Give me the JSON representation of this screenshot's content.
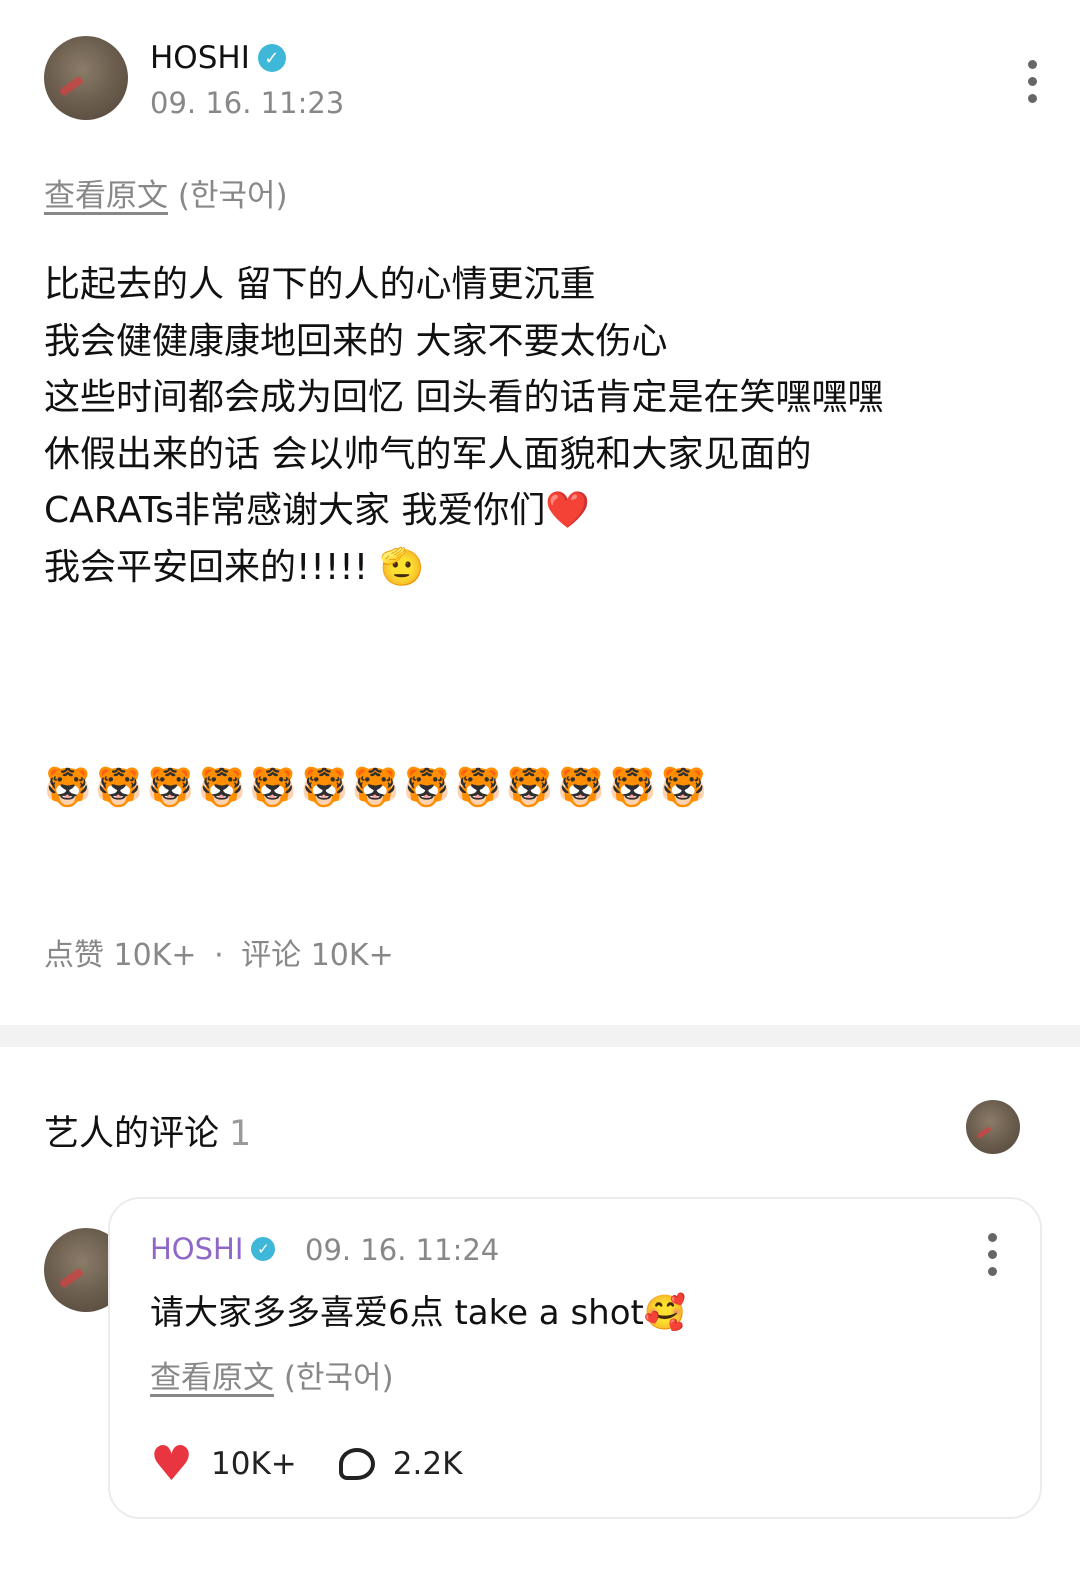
{
  "post": {
    "author": "HOSHI",
    "timestamp": "09. 16. 11:23",
    "translate_link": "查看原文",
    "translate_lang": "(한국어)",
    "body": "比起去的人 留下的人的心情更沉重\n我会健健康康地回来的 大家不要太伤心\n这些时间都会成为回忆 回头看的话肯定是在笑嘿嘿嘿\n休假出来的话 会以帅气的军人面貌和大家见面的\nCARATs非常感谢大家 我爱你们❤️\n我会平安回来的!!!!! 🫡",
    "emoji_row": "🐯🐯🐯🐯🐯🐯🐯🐯🐯🐯🐯🐯🐯",
    "likes_label": "点赞",
    "likes_count": "10K+",
    "separator": "·",
    "comments_label": "评论",
    "comments_count": "10K+"
  },
  "artist_comments": {
    "title": "艺人的评论",
    "count": "1"
  },
  "comment": {
    "author": "HOSHI",
    "timestamp": "09. 16. 11:24",
    "text": "请大家多多喜爱6点 take a shot🥰",
    "translate_link": "查看原文",
    "translate_lang": "(한국어)",
    "likes": "10K+",
    "replies": "2.2K"
  },
  "colors": {
    "verified": "#3fb7d8",
    "comment_author": "#8f67c9",
    "heart": "#e8353f",
    "muted_text": "#888888"
  }
}
